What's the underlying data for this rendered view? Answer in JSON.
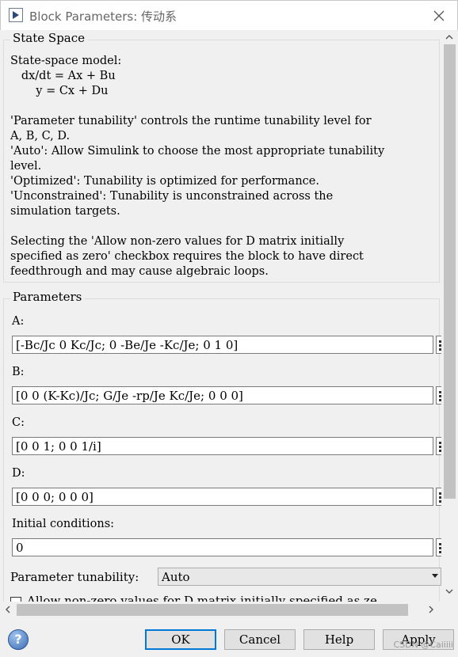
{
  "window": {
    "title": "Block Parameters: 传动系",
    "close_icon": "close-icon",
    "app_icon": "simulink-block-icon"
  },
  "state_space": {
    "group_title": "State Space",
    "description": "State-space model:\n   dx/dt = Ax + Bu\n       y = Cx + Du\n\n'Parameter tunability' controls the runtime tunability level for\nA, B, C, D.\n'Auto': Allow Simulink to choose the most appropriate tunability\nlevel.\n'Optimized': Tunability is optimized for performance.\n'Unconstrained': Tunability is unconstrained across the\nsimulation targets.\n\nSelecting the 'Allow non-zero values for D matrix initially\nspecified as zero' checkbox requires the block to have direct\nfeedthrough and may cause algebraic loops."
  },
  "parameters": {
    "group_title": "Parameters",
    "fields": [
      {
        "label": "A:",
        "value": "[-Bc/Jc 0 Kc/Jc; 0 -Be/Je -Kc/Je; 0 1 0]"
      },
      {
        "label": "B:",
        "value": "[0 0 (K-Kc)/Jc; G/Je -rp/Je Kc/Je; 0 0 0]"
      },
      {
        "label": "C:",
        "value": "[0 0 1; 0 0 1/i]"
      },
      {
        "label": "D:",
        "value": "[0 0 0; 0 0 0]"
      },
      {
        "label": "Initial conditions:",
        "value": "0"
      }
    ],
    "tunability_label": "Parameter tunability:",
    "tunability_value": "Auto",
    "checkbox_label": "Allow non-zero values for D matrix initially specified as ze",
    "checkbox_checked": false
  },
  "buttons": {
    "ok": "OK",
    "cancel": "Cancel",
    "help": "Help",
    "apply": "Apply"
  },
  "watermark": "CSDN @Caiiiii",
  "colors": {
    "dialog_bg": "#f0f0f0",
    "focus_border": "#0078d7",
    "scroll_thumb": "#c2c2c2"
  }
}
